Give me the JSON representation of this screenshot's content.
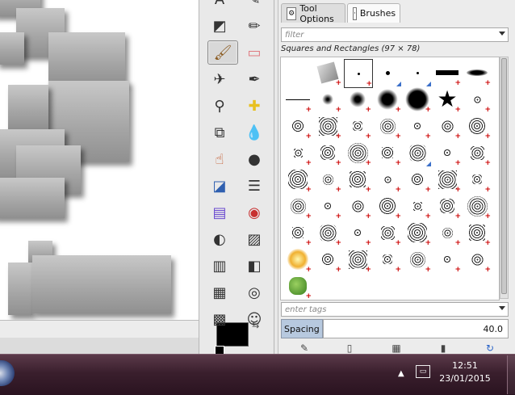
{
  "dock": {
    "tabs": [
      {
        "label": "Tool Options",
        "icon": "tool-options-icon"
      },
      {
        "label": "Brushes",
        "icon": "brush-preview-icon"
      }
    ],
    "filter_placeholder": "filter",
    "brush_title": "Squares and Rectangles (97 × 78)",
    "tags_placeholder": "enter tags",
    "spacing_label": "Spacing",
    "spacing_value": "40.0",
    "actions": [
      "edit-brush-icon",
      "new-brush-icon",
      "duplicate-brush-icon",
      "delete-brush-icon",
      "refresh-brushes-icon"
    ]
  },
  "toolbox": {
    "tools": [
      "text-tool-icon",
      "smudge-pencil-icon",
      "blend-tool-icon",
      "pencil-icon",
      "paintbrush-icon",
      "eraser-icon",
      "airbrush-icon",
      "ink-tool-icon",
      "clone-stamp-icon",
      "healing-icon",
      "perspective-clone-icon",
      "blur-sharpen-icon",
      "smudge-icon",
      "dodge-burn-icon",
      "blend-color-icon",
      "color-balance-icon",
      "hue-saturation-icon",
      "colorize-icon",
      "threshold-icon",
      "levels-icon",
      "curves-icon",
      "posterize-icon",
      "gradient-map-icon",
      "dither-icon",
      "checker-icon",
      "user-icon"
    ],
    "active_tool": "paintbrush-icon",
    "foreground_color": "#000000",
    "background_color": "#ffffff"
  },
  "taskbar": {
    "time": "12:51",
    "date": "23/01/2015"
  },
  "colors": {
    "accent": "#b7c9df",
    "taskbar": "#3a1f2d"
  }
}
